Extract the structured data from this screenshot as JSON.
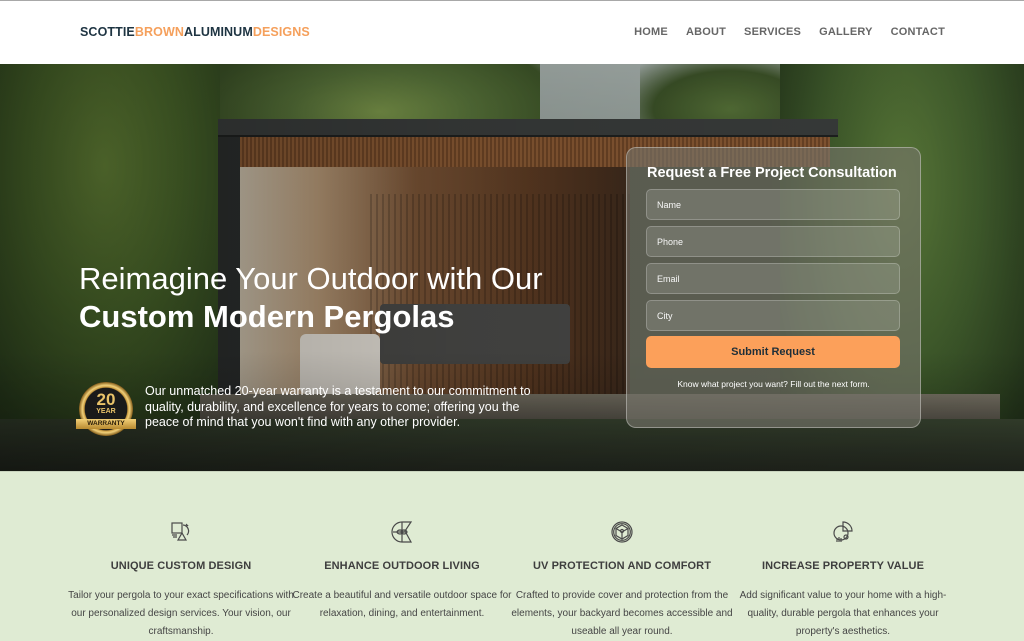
{
  "header": {
    "logo": {
      "part1": "SCOTTIE",
      "part2": "BROWN",
      "part3": "ALUMINUM",
      "part4": "DESIGNS"
    },
    "nav": [
      {
        "label": "HOME"
      },
      {
        "label": "ABOUT"
      },
      {
        "label": "SERVICES"
      },
      {
        "label": "GALLERY"
      },
      {
        "label": "CONTACT"
      }
    ]
  },
  "colors": {
    "brand_dark": "#1e3442",
    "brand_accent": "#f5a05c",
    "button": "#fca05a",
    "features_bg": "#dfebd3"
  },
  "hero": {
    "title_regular": "Reimagine Your Outdoor with Our ",
    "title_bold": "Custom Modern Pergolas",
    "badge": {
      "number": "20",
      "year": "YEAR",
      "ribbon": "WARRANTY"
    },
    "warranty_text": "Our unmatched 20-year warranty is a testament to our commitment to quality, durability, and excellence for years to come; offering you the peace of mind that you won't find with any other provider."
  },
  "form": {
    "title": "Request a Free Project Consultation",
    "fields": [
      {
        "placeholder": "Name",
        "value": ""
      },
      {
        "placeholder": "Phone",
        "value": ""
      },
      {
        "placeholder": "Email",
        "value": ""
      },
      {
        "placeholder": "City",
        "value": ""
      }
    ],
    "submit_label": "Submit Request",
    "note": "Know what project you want? Fill out the next form."
  },
  "features": [
    {
      "icon": "design-tools-icon",
      "title": "UNIQUE CUSTOM DESIGN",
      "text": "Tailor your pergola to your exact specifications with our personalized design services. Your vision, our craftsmanship."
    },
    {
      "icon": "outdoor-living-icon",
      "title": "ENHANCE OUTDOOR LIVING",
      "text": "Create a beautiful and versatile outdoor space for relaxation, dining, and entertainment."
    },
    {
      "icon": "uv-protection-icon",
      "title": "UV PROTECTION AND COMFORT",
      "text": "Crafted to provide cover and protection from the elements, your backyard becomes accessible and useable all year round."
    },
    {
      "icon": "property-value-icon",
      "title": "INCREASE PROPERTY VALUE",
      "text": "Add significant value to your home with a high-quality, durable pergola that enhances your property's aesthetics."
    }
  ]
}
